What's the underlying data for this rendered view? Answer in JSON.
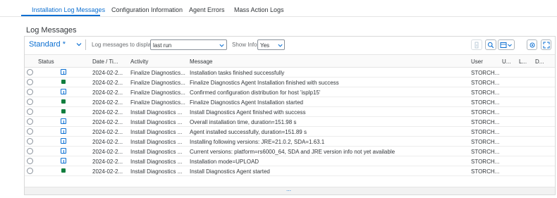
{
  "tabs": [
    {
      "label": "Installation Log Messages",
      "active": true
    },
    {
      "label": "Configuration Information",
      "active": false
    },
    {
      "label": "Agent Errors",
      "active": false
    },
    {
      "label": "Mass Action Logs",
      "active": false
    }
  ],
  "section_title": "Log Messages",
  "toolbar": {
    "variant": "Standard *",
    "display_label": "Log messages to display:",
    "display_value": "last run",
    "info_label": "Show Info:",
    "info_value": "Yes"
  },
  "columns": [
    "Status",
    "Date / Ti...",
    "Activity",
    "Message",
    "User",
    "U...",
    "L...",
    "D..."
  ],
  "rows": [
    {
      "status": "info",
      "date": "2024-02-2...",
      "activity": "Finalize Diagnostics...",
      "message": "Installation tasks finished successfully",
      "user": "STORCH..."
    },
    {
      "status": "success",
      "date": "2024-02-2...",
      "activity": "Finalize Diagnostics...",
      "message": "Finalize Diagnostics Agent Installation finished with success",
      "user": "STORCH..."
    },
    {
      "status": "info",
      "date": "2024-02-2...",
      "activity": "Finalize Diagnostics...",
      "message": "Confirmed configuration distribution for host 'isplp15'",
      "user": "STORCH..."
    },
    {
      "status": "success",
      "date": "2024-02-2...",
      "activity": "Finalize Diagnostics...",
      "message": "Finalize Diagnostics Agent Installation started",
      "user": "STORCH..."
    },
    {
      "status": "success",
      "date": "2024-02-2...",
      "activity": "Install Diagnostics ...",
      "message": "Install Diagnostics Agent finished with success",
      "user": "STORCH..."
    },
    {
      "status": "info",
      "date": "2024-02-2...",
      "activity": "Install Diagnostics ...",
      "message": "Overall installation time, duration=151.98 s",
      "user": "STORCH..."
    },
    {
      "status": "info",
      "date": "2024-02-2...",
      "activity": "Install Diagnostics ...",
      "message": "Agent installed successfully, duration=151.89 s",
      "user": "STORCH..."
    },
    {
      "status": "info",
      "date": "2024-02-2...",
      "activity": "Install Diagnostics ...",
      "message": "Installing following versions: JRE=21.0.2, SDA=1.63.1",
      "user": "STORCH..."
    },
    {
      "status": "info",
      "date": "2024-02-2...",
      "activity": "Install Diagnostics ...",
      "message": "Current versions: platform=rs6000_64, SDA and JRE version info not yet available",
      "user": "STORCH..."
    },
    {
      "status": "info",
      "date": "2024-02-2...",
      "activity": "Install Diagnostics ...",
      "message": "Installation mode=UPLOAD",
      "user": "STORCH..."
    },
    {
      "status": "success",
      "date": "2024-02-2...",
      "activity": "Install Diagnostics ...",
      "message": "Install Diagnostics Agent started",
      "user": "STORCH..."
    }
  ],
  "colors": {
    "accent": "#0a6ed1",
    "success": "#107e3e",
    "text": "#32363a"
  },
  "icons": [
    "chevron-down-icon",
    "info-icon",
    "success-icon",
    "search-icon",
    "export-icon",
    "settings-icon",
    "fullscreen-icon"
  ]
}
